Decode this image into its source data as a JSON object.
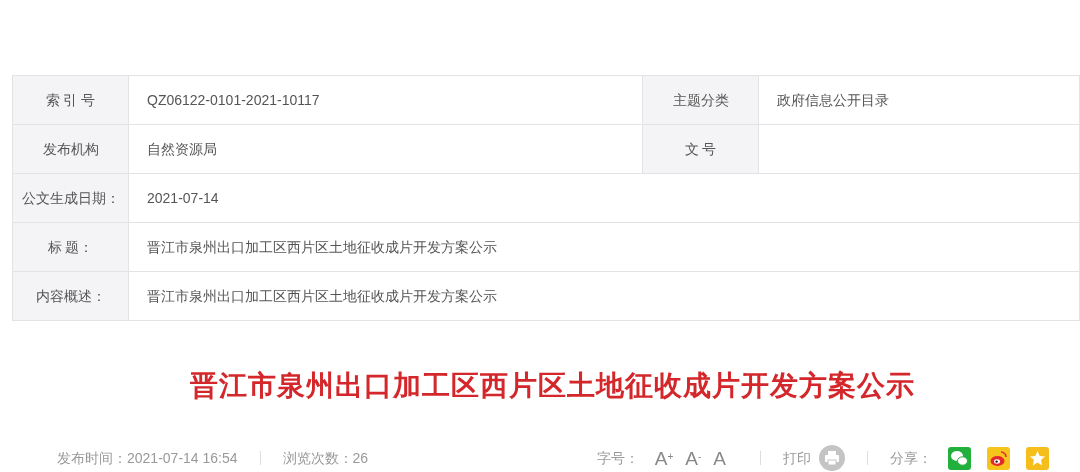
{
  "info_table": {
    "rows": [
      {
        "label": "索 引 号",
        "value": "QZ06122-0101-2021-10117",
        "label_2": "主题分类",
        "value_2": "政府信息公开目录"
      },
      {
        "label": "发布机构",
        "value": "自然资源局",
        "label_2": "文 号"
      },
      {
        "label": "公文生成日期：",
        "value": "2021-07-14"
      },
      {
        "label": "标 题：",
        "value": "晋江市泉州出口加工区西片区土地征收成片开发方案公示"
      },
      {
        "label": "内容概述：",
        "value": "晋江市泉州出口加工区西片区土地征收成片开发方案公示"
      }
    ]
  },
  "article": {
    "title": "晋江市泉州出口加工区西片区土地征收成片开发方案公示"
  },
  "footer": {
    "meta": [
      "发布时间：2021-07-14 16:54",
      "浏览次数：26"
    ],
    "font_size_label": "字号：",
    "font_size_buttons": [
      "A$^{+}$",
      "A$^{-}$",
      "A"
    ],
    "print_label": "打印",
    "share_label": "分享："
  }
}
